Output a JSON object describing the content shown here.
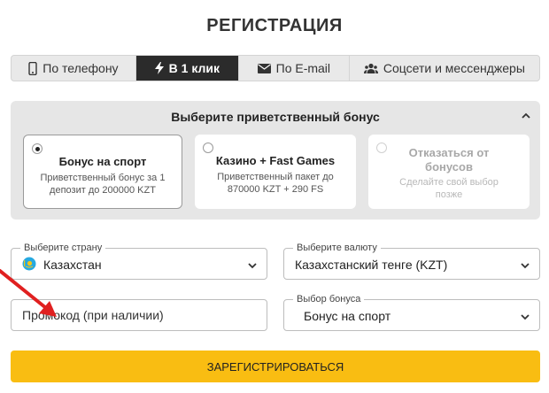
{
  "page": {
    "title": "РЕГИСТРАЦИЯ"
  },
  "tabs": [
    {
      "label": "По телефону",
      "icon": "phone-icon",
      "active": false
    },
    {
      "label": "В 1 клик",
      "icon": "lightning-icon",
      "active": true
    },
    {
      "label": "По E-mail",
      "icon": "envelope-icon",
      "active": false
    },
    {
      "label": "Соцсети и мессенджеры",
      "icon": "users-icon",
      "active": false
    }
  ],
  "bonus": {
    "heading": "Выберите приветственный бонус",
    "options": [
      {
        "title": "Бонус на спорт",
        "desc": "Приветственный бонус за 1 депозит до 200000 KZT",
        "selected": true
      },
      {
        "title": "Казино + Fast Games",
        "desc": "Приветственный пакет до 870000 KZT + 290 FS",
        "selected": false
      },
      {
        "title": "Отказаться от бонусов",
        "desc": "Сделайте свой выбор позже",
        "selected": false,
        "disabled": true
      }
    ]
  },
  "form": {
    "country": {
      "label": "Выберите страну",
      "value": "Казахстан",
      "flag": "kazakhstan-flag-icon"
    },
    "currency": {
      "label": "Выберите валюту",
      "value": "Казахстанский тенге (KZT)"
    },
    "promo": {
      "placeholder": "Промокод (при наличии)",
      "value": ""
    },
    "bonus_select": {
      "label": "Выбор бонуса",
      "value": "Бонус на спорт"
    }
  },
  "submit": {
    "label": "ЗАРЕГИСТРИРОВАТЬСЯ"
  },
  "colors": {
    "accent": "#f9bd12",
    "active_tab": "#2b2b2b",
    "panel": "#e6e6e6",
    "annotation": "#e02020"
  }
}
